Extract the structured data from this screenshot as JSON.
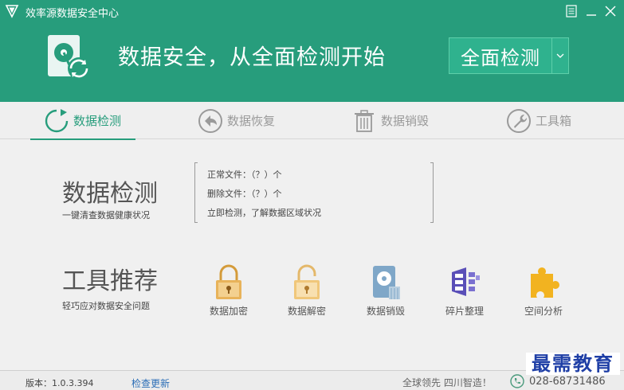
{
  "app": {
    "title": "效率源数据安全中心"
  },
  "header": {
    "slogan": "数据安全，从全面检测开始",
    "scan_button": "全面检测"
  },
  "tabs": [
    {
      "label": "数据检测",
      "icon": "refresh-circle-icon",
      "active": true
    },
    {
      "label": "数据恢复",
      "icon": "back-arrow-icon",
      "active": false
    },
    {
      "label": "数据销毁",
      "icon": "trash-icon",
      "active": false
    },
    {
      "label": "工具箱",
      "icon": "wrench-icon",
      "active": false
    }
  ],
  "detect": {
    "title": "数据检测",
    "subtitle": "一键清查数据健康状况",
    "normal_files": "正常文件：（？）个",
    "deleted_files": "删除文件：（？）个",
    "hint": "立即检测，了解数据区域状况"
  },
  "tools": {
    "title": "工具推荐",
    "subtitle": "轻巧应对数据安全问题",
    "items": [
      {
        "label": "数据加密",
        "icon": "lock-icon"
      },
      {
        "label": "数据解密",
        "icon": "unlock-icon"
      },
      {
        "label": "数据销毁",
        "icon": "disk-shred-icon"
      },
      {
        "label": "碎片整理",
        "icon": "defrag-icon"
      },
      {
        "label": "空间分析",
        "icon": "puzzle-icon"
      }
    ]
  },
  "footer": {
    "version": "版本：1.0.3.394",
    "update": "检查更新",
    "slogan": "全球领先 四川智造！",
    "phone": "028-68731486"
  },
  "watermark": "最需教育",
  "colors": {
    "brand": "#279d7c",
    "button": "#2fb28e",
    "link": "#2a6db6"
  }
}
